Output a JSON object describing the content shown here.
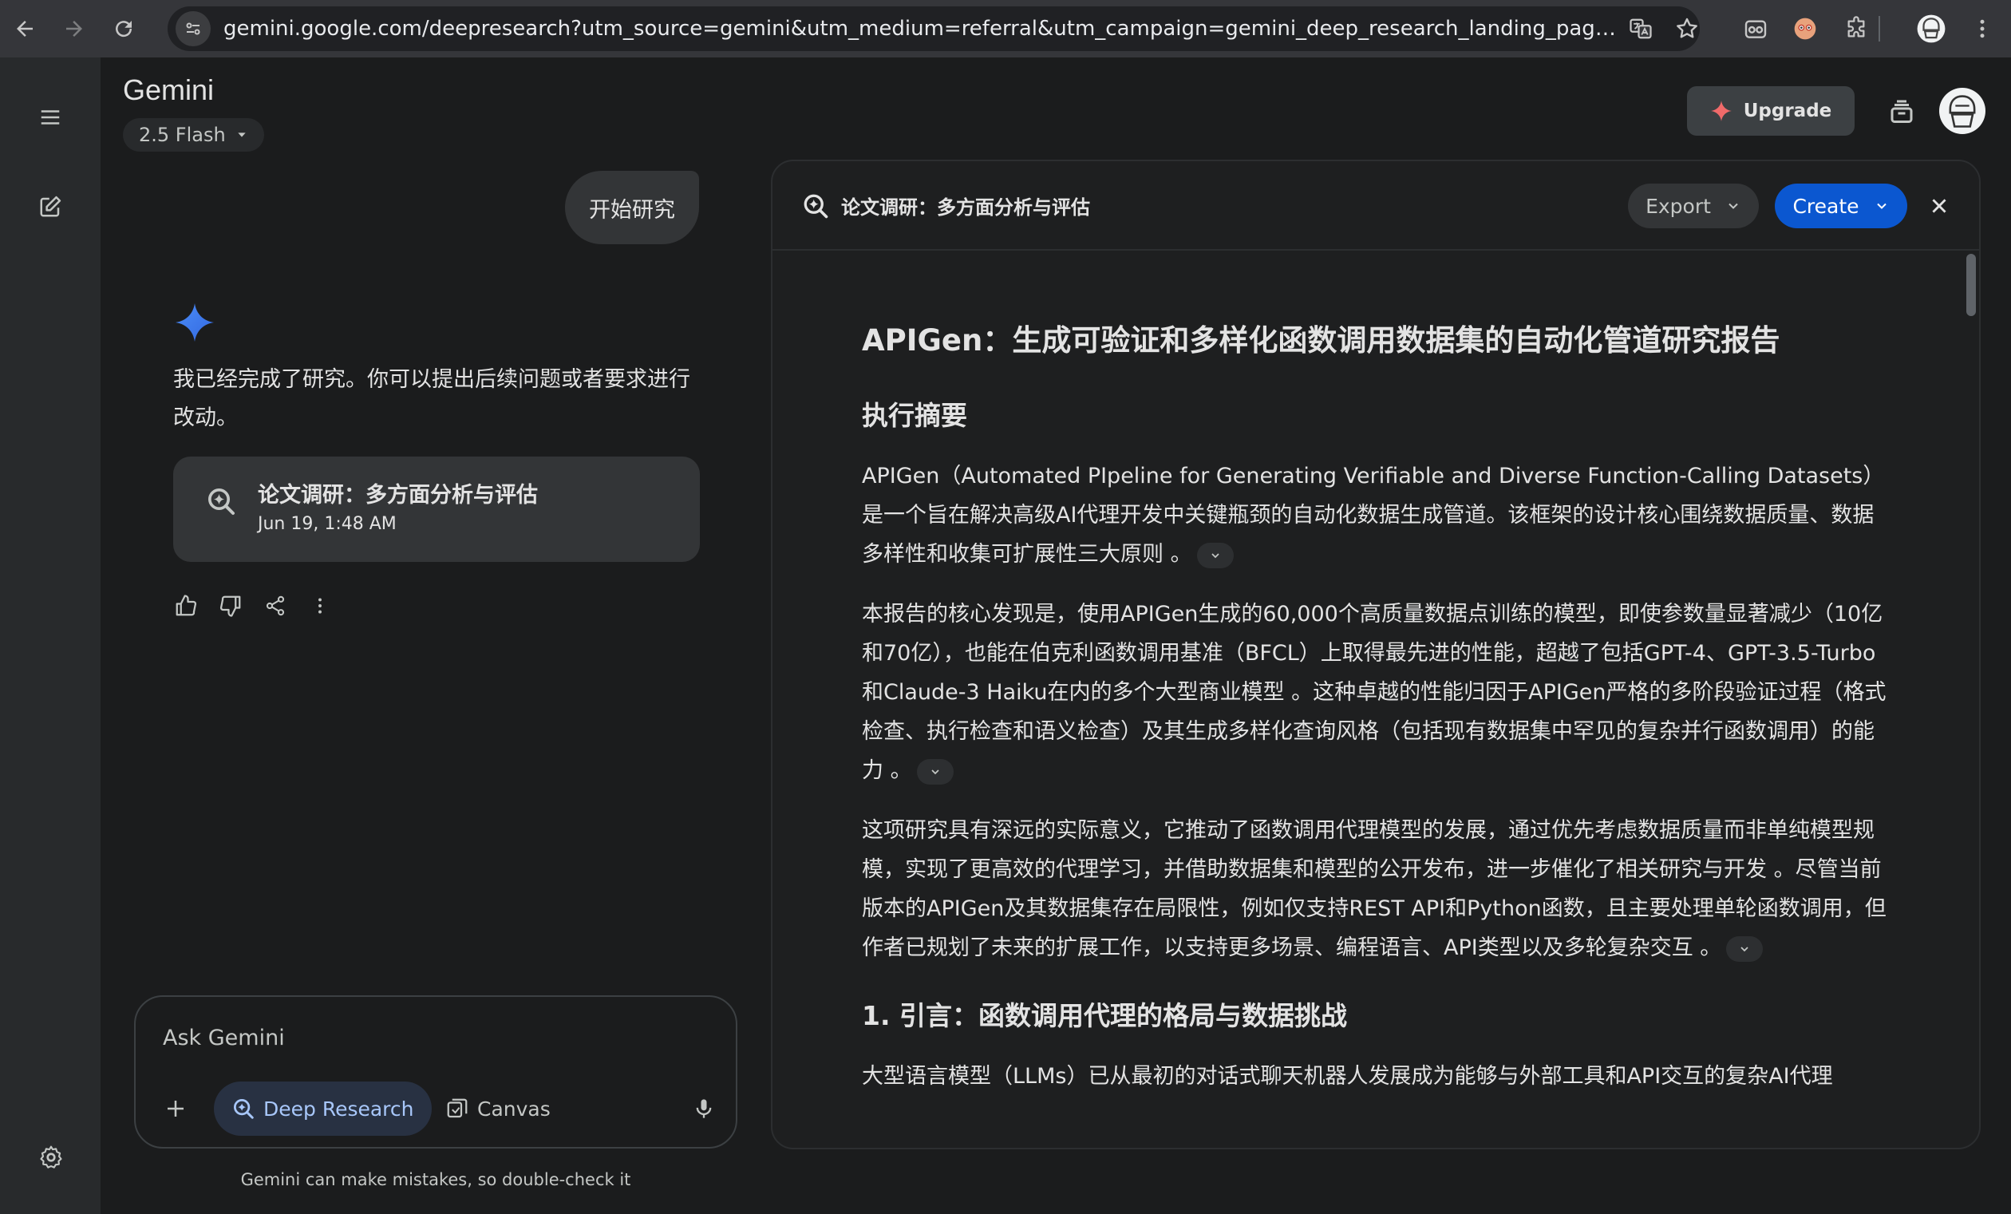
{
  "browser": {
    "url": "gemini.google.com/deepresearch?utm_source=gemini&utm_medium=referral&utm_campaign=gemini_deep_research_landing_page&redirect=ho..."
  },
  "app": {
    "title": "Gemini",
    "model": "2.5 Flash",
    "upgrade_label": "Upgrade"
  },
  "chat": {
    "user_message": "开始研究",
    "reply": "我已经完成了研究。你可以提出后续问题或者要求进行改动。",
    "report_card": {
      "title": "论文调研：多方面分析与评估",
      "date": "Jun 19, 1:48 AM"
    }
  },
  "composer": {
    "placeholder": "Ask Gemini",
    "deep_research_label": "Deep Research",
    "canvas_label": "Canvas"
  },
  "disclaimer": "Gemini can make mistakes, so double-check it",
  "panel": {
    "title": "论文调研：多方面分析与评估",
    "export_label": "Export",
    "create_label": "Create",
    "doc": {
      "h1": "APIGen：生成可验证和多样化函数调用数据集的自动化管道研究报告",
      "summary_heading": "执行摘要",
      "p1": "APIGen（Automated PIpeline for Generating Verifiable and Diverse Function-Calling Datasets）是一个旨在解决高级AI代理开发中关键瓶颈的自动化数据生成管道。该框架的设计核心围绕数据质量、数据多样性和收集可扩展性三大原则 。",
      "p2": "本报告的核心发现是，使用APIGen生成的60,000个高质量数据点训练的模型，即使参数量显著减少（10亿和70亿），也能在伯克利函数调用基准（BFCL）上取得最先进的性能，超越了包括GPT-4、GPT-3.5-Turbo和Claude-3 Haiku在内的多个大型商业模型 。这种卓越的性能归因于APIGen严格的多阶段验证过程（格式检查、执行检查和语义检查）及其生成多样化查询风格（包括现有数据集中罕见的复杂并行函数调用）的能力 。",
      "p3": "这项研究具有深远的实际意义，它推动了函数调用代理模型的发展，通过优先考虑数据质量而非单纯模型规模，实现了更高效的代理学习，并借助数据集和模型的公开发布，进一步催化了相关研究与开发 。尽管当前版本的APIGen及其数据集存在局限性，例如仅支持REST API和Python函数，且主要处理单轮函数调用，但作者已规划了未来的扩展工作，以支持更多场景、编程语言、API类型以及多轮复杂交互 。",
      "section1_heading": "1. 引言：函数调用代理的格局与数据挑战",
      "p4": "大型语言模型（LLMs）已从最初的对话式聊天机器人发展成为能够与外部工具和API交互的复杂AI代理"
    }
  }
}
